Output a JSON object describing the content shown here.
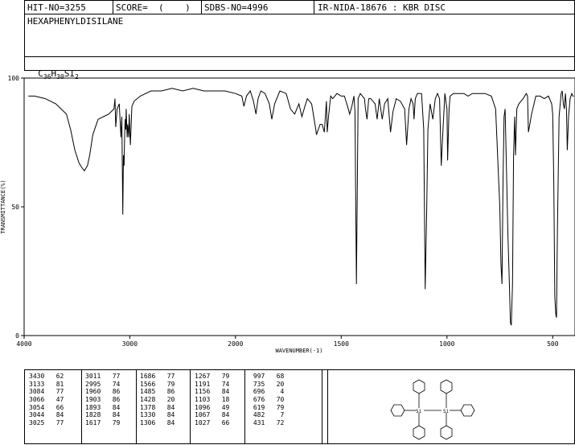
{
  "header": {
    "hit_no": "HIT-NO=3255",
    "score": "SCORE=  (    )",
    "sdbs_no": "SDBS-NO=4996",
    "ir_nida": "IR-NIDA-18676 : KBR DISC",
    "compound_name": "HEXAPHENYLDISILANE",
    "formula_c": "C",
    "formula_c_sub": "36",
    "formula_h": "H",
    "formula_h_sub": "30",
    "formula_si": "SI",
    "formula_si_sub": "2"
  },
  "chart_data": {
    "type": "line",
    "xlabel": "WAVENUMBER(-1)",
    "ylabel": "TRANSMITTANCE(%)",
    "xlim": [
      4000,
      400
    ],
    "ylim": [
      0,
      100
    ],
    "x_ticks": [
      "4000",
      "3000",
      "2000",
      "1500",
      "1000",
      "500"
    ],
    "y_ticks": [
      "100",
      "50",
      "0"
    ],
    "series": [
      {
        "x": [
          3960,
          3900,
          3800,
          3700,
          3600,
          3560,
          3520,
          3480,
          3450,
          3430,
          3400,
          3380,
          3350,
          3300,
          3250,
          3200,
          3150,
          3140,
          3133,
          3120,
          3100,
          3084,
          3075,
          3066,
          3060,
          3054,
          3049,
          3044,
          3038,
          3034,
          3025,
          3020,
          3011,
          3005,
          2995,
          2980,
          2960,
          2900,
          2800,
          2700,
          2600,
          2500,
          2400,
          2300,
          2200,
          2100,
          2000,
          1970,
          1960,
          1948,
          1930,
          1915,
          1903,
          1893,
          1880,
          1860,
          1840,
          1828,
          1815,
          1790,
          1760,
          1740,
          1720,
          1700,
          1686,
          1672,
          1660,
          1640,
          1620,
          1617,
          1600,
          1590,
          1580,
          1570,
          1566,
          1560,
          1550,
          1540,
          1520,
          1500,
          1485,
          1470,
          1460,
          1450,
          1440,
          1435,
          1428,
          1420,
          1410,
          1400,
          1390,
          1385,
          1378,
          1370,
          1360,
          1340,
          1330,
          1320,
          1306,
          1295,
          1280,
          1267,
          1255,
          1240,
          1220,
          1200,
          1191,
          1180,
          1170,
          1160,
          1156,
          1150,
          1140,
          1120,
          1110,
          1103,
          1096,
          1090,
          1080,
          1067,
          1055,
          1045,
          1035,
          1027,
          1020,
          1010,
          1000,
          997,
          990,
          985,
          970,
          950,
          920,
          900,
          880,
          850,
          820,
          790,
          770,
          750,
          745,
          740,
          735,
          730,
          725,
          720,
          712,
          705,
          700,
          696,
          690,
          685,
          680,
          676,
          670,
          660,
          640,
          625,
          619,
          615,
          600,
          580,
          560,
          540,
          520,
          505,
          500,
          495,
          490,
          485,
          482,
          478,
          470,
          460,
          455,
          450,
          445,
          440,
          435,
          431,
          425,
          418,
          410,
          405,
          400
        ],
        "y": [
          93,
          93,
          92,
          90,
          86,
          80,
          72,
          67,
          65,
          64,
          66,
          70,
          78,
          84,
          85,
          86,
          88,
          92,
          81,
          88,
          90,
          77,
          85,
          47,
          70,
          66,
          78,
          84,
          80,
          88,
          77,
          82,
          77,
          86,
          74,
          89,
          91,
          93,
          95,
          95,
          96,
          95,
          96,
          95,
          95,
          95,
          94,
          93,
          89,
          93,
          95,
          91,
          86,
          92,
          95,
          94,
          90,
          84,
          90,
          95,
          94,
          88,
          86,
          90,
          85,
          89,
          92,
          90,
          80,
          78,
          82,
          82,
          79,
          91,
          79,
          85,
          93,
          92,
          94,
          93,
          93,
          89,
          86,
          89,
          93,
          87,
          20,
          92,
          94,
          93,
          92,
          88,
          84,
          92,
          92,
          90,
          84,
          92,
          84,
          90,
          92,
          79,
          87,
          92,
          91,
          88,
          74,
          88,
          92,
          90,
          84,
          92,
          94,
          94,
          80,
          18,
          49,
          80,
          90,
          84,
          92,
          94,
          92,
          66,
          78,
          94,
          88,
          68,
          88,
          93,
          94,
          94,
          94,
          93,
          94,
          94,
          94,
          93,
          88,
          50,
          28,
          20,
          60,
          85,
          88,
          70,
          40,
          20,
          5,
          4,
          20,
          70,
          85,
          70,
          88,
          90,
          92,
          94,
          93,
          79,
          86,
          93,
          93,
          92,
          93,
          90,
          86,
          60,
          15,
          8,
          7,
          40,
          85,
          94,
          95,
          90,
          88,
          94,
          88,
          72,
          85,
          92,
          94,
          93,
          93
        ]
      }
    ],
    "peak_table": [
      [
        [
          "3430",
          "62"
        ],
        [
          "3133",
          "81"
        ],
        [
          "3084",
          "77"
        ],
        [
          "3066",
          "47"
        ],
        [
          "3054",
          "66"
        ],
        [
          "3044",
          "84"
        ],
        [
          "3025",
          "77"
        ]
      ],
      [
        [
          "3011",
          "77"
        ],
        [
          "2995",
          "74"
        ],
        [
          "1960",
          "86"
        ],
        [
          "1903",
          "86"
        ],
        [
          "1893",
          "84"
        ],
        [
          "1828",
          "84"
        ],
        [
          "1617",
          "79"
        ]
      ],
      [
        [
          "1686",
          "77"
        ],
        [
          "1566",
          "79"
        ],
        [
          "1485",
          "86"
        ],
        [
          "1428",
          "20"
        ],
        [
          "1378",
          "84"
        ],
        [
          "1330",
          "84"
        ],
        [
          "1306",
          "84"
        ]
      ],
      [
        [
          "1267",
          "79"
        ],
        [
          "1191",
          "74"
        ],
        [
          "1156",
          "84"
        ],
        [
          "1103",
          "18"
        ],
        [
          "1096",
          "49"
        ],
        [
          "1067",
          "84"
        ],
        [
          "1027",
          "66"
        ]
      ],
      [
        [
          "997",
          "68"
        ],
        [
          "735",
          "20"
        ],
        [
          "696",
          "4"
        ],
        [
          "676",
          "70"
        ],
        [
          "619",
          "79"
        ],
        [
          "482",
          "7"
        ],
        [
          "431",
          "72"
        ]
      ]
    ]
  },
  "structure": {
    "si_label": "Si"
  }
}
